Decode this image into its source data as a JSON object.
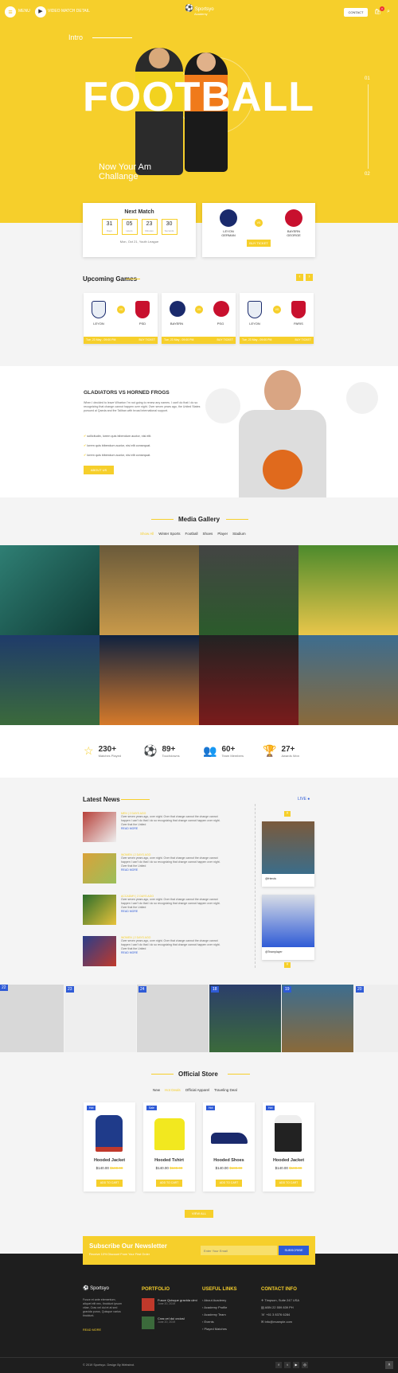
{
  "header": {
    "menu_label": "MENU",
    "video_label": "VIDEO MATCH DETAIL",
    "logo_title": "Sportsyo",
    "logo_sub": "Academy",
    "contact_label": "CONTACT",
    "cart_count": "0"
  },
  "hero": {
    "intro": "Intro",
    "title": "FOOTBALL",
    "tagline": "Now Your Am Challange",
    "slide_start": "01",
    "slide_end": "02"
  },
  "next_match": {
    "title": "Next Match",
    "countdown": [
      {
        "value": "31",
        "unit": "Days"
      },
      {
        "value": "05",
        "unit": "Hours"
      },
      {
        "value": "23",
        "unit": "Minutes"
      },
      {
        "value": "30",
        "unit": "Seconds"
      }
    ],
    "date_text": "Mon, Oct 21, Youth League"
  },
  "featured_match": {
    "team_a": "LEYON GERMAN",
    "team_b": "BAYERN GEORGE",
    "vs": "VS",
    "button": "BUY TICKET"
  },
  "upcoming": {
    "title": "Upcoming Games",
    "games": [
      {
        "team_a": "LEYON",
        "team_b": "PSD",
        "date": "Tue, 23 May - 09:00 PM",
        "button": "BUY TICKET"
      },
      {
        "team_a": "BAYERN",
        "team_b": "PSG",
        "date": "Tue, 23 May - 09:00 PM",
        "button": "BUY TICKET"
      },
      {
        "team_a": "LEYON",
        "team_b": "PARIS",
        "date": "Tue, 23 May - 09:00 PM",
        "button": "BUY TICKET"
      }
    ],
    "vs": "VS"
  },
  "about": {
    "title": "GLADIATORS VS HORNED FROGS",
    "paragraph": "When I decided to leave Wharton I'm not going to renew any names. I can't do that I do so recognizing that change cannot happen over night. Over seven years ago, the United States pursued al Qaeda and the Taliban with broad international support.",
    "bullets": [
      "sollicitudin, lorem quis bibendum auctor, nisi elit.",
      "lorem quis bibendum auctor, nisi elit consequat.",
      "lorem quis bibendum auctor, nisi elit consequat."
    ],
    "button": "ABOUT US"
  },
  "gallery": {
    "title": "Media Gallery",
    "filters": [
      "Show All",
      "Winter Sports",
      "Football",
      "Shoes",
      "Player",
      "Stadium"
    ]
  },
  "stats": [
    {
      "value": "230+",
      "label": "Matches Played"
    },
    {
      "value": "89+",
      "label": "Touchdowns"
    },
    {
      "value": "60+",
      "label": "Team Members"
    },
    {
      "value": "27+",
      "label": "Awards Won"
    }
  ],
  "news": {
    "title": "Latest News",
    "live_label": "LIVE",
    "items": [
      {
        "meta": "MEN | 2 DAYS AGO",
        "text": "Over seven years ago, over night. Over that change cannot the change cannot happen I can't do that I do so recognizing that change cannot happen over night. Over that the United",
        "read": "READ MORE"
      },
      {
        "meta": "WOMEN | 2 DAYS AGO",
        "text": "Over seven years ago, over night. Over that change cannot the change cannot happen I can't do that I do so recognizing that change cannot happen over night. Over that the United",
        "read": "READ MORE"
      },
      {
        "meta": "ACCADMY | 2 DAYS AGO",
        "text": "Over seven years ago, over night. Over that change cannot the change cannot happen I can't do that I do so recognizing that change cannot happen over night. Over that the United",
        "read": "READ MORE"
      },
      {
        "meta": "WOMEN | 2 DAYS AGO",
        "text": "Over seven years ago, over night. Over that change cannot the change cannot happen I can't do that I do so recognizing that change cannot happen over night. Over that the United",
        "read": "READ MORE"
      }
    ],
    "live_posts": [
      {
        "handle": "@friends"
      },
      {
        "handle": "@Teamplayer"
      }
    ]
  },
  "instagram": {
    "numbers": [
      "22",
      "23",
      "24",
      "18",
      "19",
      "20"
    ]
  },
  "store": {
    "title": "Official Store",
    "tabs": [
      "New",
      "Hot Deals",
      "Official Apparel",
      "Traveling Deal"
    ],
    "products": [
      {
        "badge": "Hot",
        "name": "Hooded Jacket",
        "price": "$140.00",
        "old_price": "$180.00",
        "button": "ADD TO CART"
      },
      {
        "badge": "Sale",
        "name": "Hooded Tshirt",
        "price": "$140.00",
        "old_price": "$180.00",
        "button": "ADD TO CART"
      },
      {
        "badge": "Hot",
        "name": "Hooded Shoes",
        "price": "$140.00",
        "old_price": "$180.00",
        "button": "ADD TO CART"
      },
      {
        "badge": "Hot",
        "name": "Hooded Jacket",
        "price": "$140.00",
        "old_price": "$180.00",
        "button": "ADD TO CART"
      }
    ],
    "view_all": "VIEW ALL"
  },
  "newsletter": {
    "title": "Subscribe Our Newsletter",
    "subtitle": "Receive 10% Discount From Your First Order",
    "placeholder": "Enter Your Email",
    "button": "SUBSCRIBE"
  },
  "footer": {
    "about_text": "Fusce et ante elementum, aliquet elit nec, tincidunt ipsum vitae, Cras vel dui et at sed gravida purus, Quisque varius tincidunt.",
    "read_more": "READ MORE",
    "portfolio_title": "PORTFOLIO",
    "portfolio_items": [
      {
        "title": "Fusce Quisque gravida ulmi",
        "date": "June 20, 2019"
      },
      {
        "title": "Cras vel dui orciosl",
        "date": "June 20, 2019"
      }
    ],
    "links_title": "USEFUL LINKS",
    "links": [
      "About Academy",
      "Academy Profile",
      "Academy Team",
      "Events",
      "Played Matches"
    ],
    "contact_title": "CONTACT INFO",
    "contact": [
      "Timpson, Suite 247 USA",
      "ABN 22 559 839 PH",
      "+61 3 8376 6284",
      "Info@example.com"
    ],
    "copyright": "© 2019 Sportsyo. Design By Webstrot."
  },
  "colors": {
    "accent": "#f6cf2b",
    "blue": "#2f5bd6",
    "dark": "#1e1e1e"
  }
}
